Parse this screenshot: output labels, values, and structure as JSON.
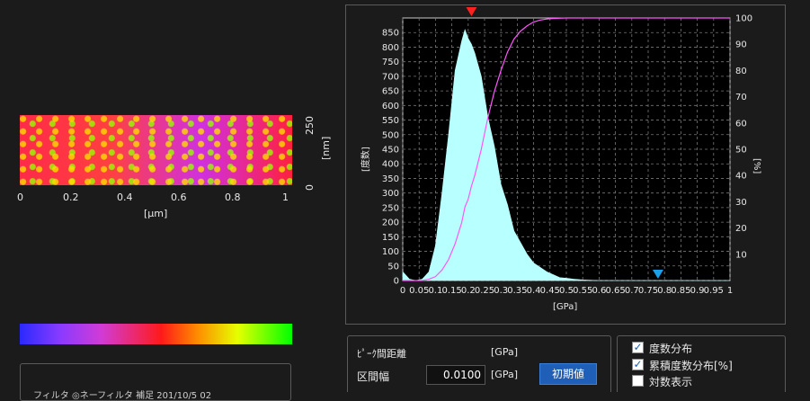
{
  "left": {
    "map": {
      "x_ticks": [
        "0",
        "0.2",
        "0.4",
        "0.6",
        "0.8",
        "1"
      ],
      "x_unit": "[μm]",
      "y_ticks": [
        "250",
        "0"
      ],
      "y_unit": "[nm]"
    },
    "footer_text": "フィルタ  ◎ネーフィルタ  補足  201/10/5 02"
  },
  "histogram": {
    "left_axis_label": "[度数]",
    "right_axis_label": "[%]",
    "x_unit": "[GPa]"
  },
  "controls": {
    "peak_distance_label": "ﾋﾟｰｸ間距離",
    "peak_distance_unit": "[GPa]",
    "interval_label": "区間幅",
    "interval_value": "0.0100",
    "interval_unit": "[GPa]",
    "reset_button": "初期値"
  },
  "options": {
    "freq": {
      "label": "度数分布",
      "checked": true
    },
    "cumulative": {
      "label": "累積度数分布[%]",
      "checked": true
    },
    "log": {
      "label": "対数表示",
      "checked": false
    }
  },
  "chart_data": {
    "type": "area",
    "x": [
      0,
      0.02,
      0.04,
      0.06,
      0.08,
      0.1,
      0.12,
      0.14,
      0.16,
      0.18,
      0.19,
      0.2,
      0.21,
      0.22,
      0.24,
      0.26,
      0.28,
      0.3,
      0.32,
      0.34,
      0.36,
      0.38,
      0.4,
      0.42,
      0.44,
      0.46,
      0.48,
      0.5,
      0.52,
      0.55,
      0.6,
      0.7,
      0.8,
      1.0
    ],
    "series": [
      {
        "values": [
          30,
          5,
          0,
          5,
          30,
          120,
          300,
          500,
          720,
          820,
          860,
          830,
          810,
          780,
          700,
          560,
          460,
          330,
          260,
          170,
          130,
          90,
          60,
          45,
          30,
          20,
          10,
          8,
          5,
          2,
          0,
          0,
          0,
          0
        ]
      }
    ],
    "cumulative": [
      0,
      0,
      0,
      0,
      0.5,
      1.5,
      4,
      8,
      14,
      22,
      28,
      31,
      36,
      40,
      50,
      62,
      72,
      80,
      87,
      92,
      95,
      97,
      98.5,
      99.2,
      99.6,
      99.8,
      99.9,
      100,
      100,
      100,
      100,
      100,
      100,
      100
    ],
    "x_ticks": [
      "0",
      "0.05",
      "0.1",
      "0.15",
      "0.2",
      "0.25",
      "0.3",
      "0.35",
      "0.4",
      "0.45",
      "0.5",
      "0.55",
      "0.6",
      "0.65",
      "0.7",
      "0.75",
      "0.8",
      "0.85",
      "0.9",
      "0.95",
      "1"
    ],
    "y_ticks": [
      "0",
      "50",
      "100",
      "150",
      "200",
      "250",
      "300",
      "350",
      "400",
      "450",
      "500",
      "550",
      "600",
      "650",
      "700",
      "750",
      "800",
      "850"
    ],
    "y2_ticks": [
      "10",
      "20",
      "30",
      "40",
      "50",
      "60",
      "70",
      "80",
      "90",
      "100"
    ],
    "xlim": [
      0,
      1
    ],
    "ylim": [
      0,
      900
    ],
    "y2lim": [
      0,
      100
    ],
    "grid": true,
    "markers": [
      {
        "x": 0.21,
        "color": "#ff2020"
      },
      {
        "x": 0.78,
        "color": "#1aa0e6"
      }
    ],
    "fill_color": "#b8ffff",
    "cumulative_color": "#ff55ff"
  }
}
